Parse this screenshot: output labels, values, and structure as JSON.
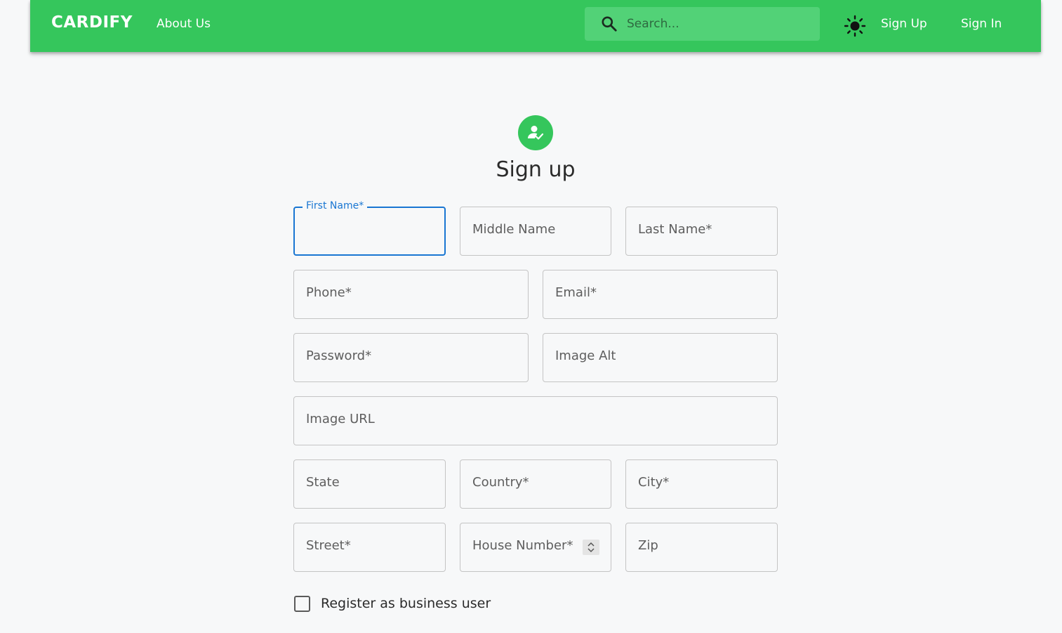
{
  "header": {
    "brand": "CARDIFY",
    "about_label": "About Us",
    "search_placeholder": "Search...",
    "sign_up_label": "Sign Up",
    "sign_in_label": "Sign In",
    "icons": {
      "search": "search-icon",
      "theme": "sun-icon"
    },
    "colors": {
      "bar": "#35c65c",
      "search_bg": "#52d277"
    }
  },
  "form": {
    "title": "Sign up",
    "avatar_icon": "person-check-icon",
    "fields": {
      "first_name": "First Name*",
      "middle_name": "Middle Name",
      "last_name": "Last Name*",
      "phone": "Phone*",
      "email": "Email*",
      "password": "Password*",
      "image_alt": "Image Alt",
      "image_url": "Image URL",
      "state": "State",
      "country": "Country*",
      "city": "City*",
      "street": "Street*",
      "house_number": "House Number*",
      "zip": "Zip"
    },
    "business_checkbox_label": "Register as business user",
    "business_checked": false,
    "focus_color": "#1976d2"
  }
}
